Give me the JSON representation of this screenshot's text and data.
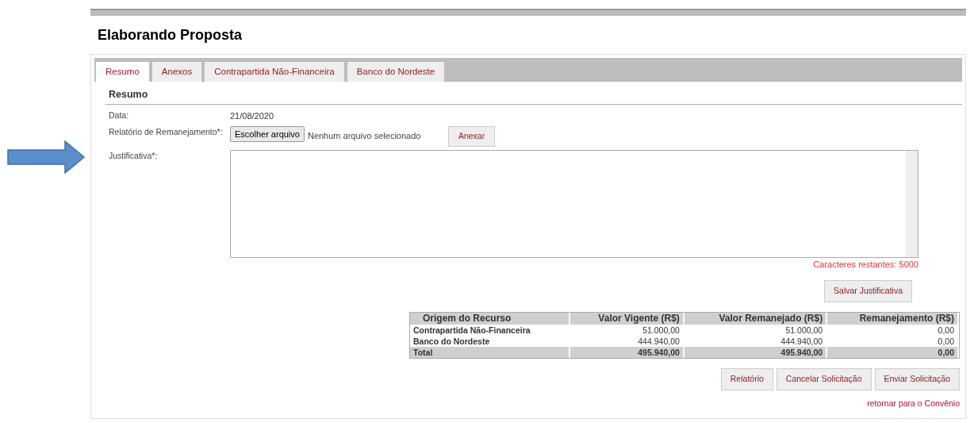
{
  "page_title": "Elaborando Proposta",
  "tabs": [
    {
      "label": "Resumo",
      "selected": true
    },
    {
      "label": "Anexos",
      "selected": false
    },
    {
      "label": "Contrapartida Não-Financeira",
      "selected": false
    },
    {
      "label": "Banco do Nordeste",
      "selected": false
    }
  ],
  "section_title": "Resumo",
  "form": {
    "date_label": "Data:",
    "date_value": "21/08/2020",
    "report_label": "Relatório de Remanejamento*:",
    "file_button": "Escolher arquivo",
    "file_status": "Nenhum arquivo selecionado",
    "attach_button": "Anexar",
    "justification_label": "Justificativa*:",
    "remaining": "Caracteres restantes: 5000",
    "save_button": "Salvar Justificativa"
  },
  "table": {
    "columns": [
      "Origem do Recurso",
      "Valor Vigente (R$)",
      "Valor Remanejado (R$)",
      "Remanejamento (R$)"
    ],
    "rows": [
      [
        "Contrapartida Não-Financeira",
        "51.000,00",
        "51.000,00",
        "0,00"
      ],
      [
        "Banco do Nordeste",
        "444.940,00",
        "444.940,00",
        "0,00"
      ]
    ],
    "total": [
      "Total",
      "495.940,00",
      "495.940,00",
      "0,00"
    ]
  },
  "buttons": [
    "Relatório",
    "Cancelar Solicitação",
    "Enviar Solicitação"
  ],
  "back_link": "retornar para o Convênio"
}
